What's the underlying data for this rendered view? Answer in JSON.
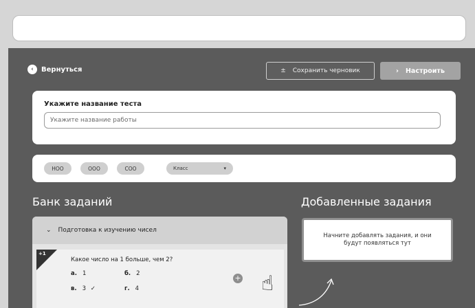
{
  "header": {
    "back_label": "Вернуться",
    "draft_label": "Сохранить черновик",
    "setup_label": "Настроить"
  },
  "title_section": {
    "label": "Укажите название теста",
    "placeholder": "Укажите название работы"
  },
  "filters": {
    "chips": [
      "НОО",
      "ООО",
      "СОО"
    ],
    "class_label": "Класс"
  },
  "bank": {
    "heading": "Банк заданий",
    "category": "Подготовка к изучению чисел",
    "task": {
      "badge": "+1",
      "question": "Какое число на 1 больше, чем 2?",
      "options": [
        {
          "letter": "а.",
          "value": "1"
        },
        {
          "letter": "б.",
          "value": "2"
        },
        {
          "letter": "в.",
          "value": "3"
        },
        {
          "letter": "г.",
          "value": "4"
        }
      ],
      "correct_mark": "✓"
    }
  },
  "added": {
    "heading": "Добавленные задания",
    "empty_text": "Начните добавлять задания, и они будут появляться тут"
  },
  "icons": {
    "back": "chevron-left-icon",
    "draft": "plus-minus-icon",
    "setup": "chevron-right-icon",
    "dropdown": "triangle-down-icon",
    "category_toggle": "chevron-down-icon",
    "add": "plus-icon",
    "cursor": "hand-pointer-icon"
  }
}
